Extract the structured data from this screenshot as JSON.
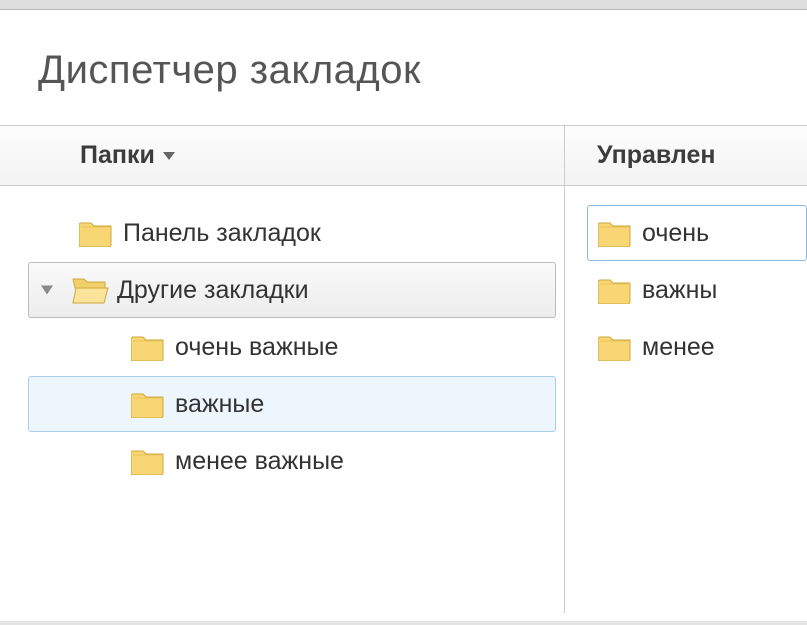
{
  "header": {
    "title": "Диспетчер закладок"
  },
  "toolbar": {
    "folders_label": "Папки",
    "manage_label": "Управлен"
  },
  "tree": {
    "items": [
      {
        "label": "Панель закладок"
      },
      {
        "label": "Другие закладки"
      },
      {
        "label": "очень важные"
      },
      {
        "label": "важные"
      },
      {
        "label": "менее важные"
      }
    ]
  },
  "list": {
    "items": [
      {
        "label": "очень "
      },
      {
        "label": "важны"
      },
      {
        "label": "менее "
      }
    ]
  }
}
